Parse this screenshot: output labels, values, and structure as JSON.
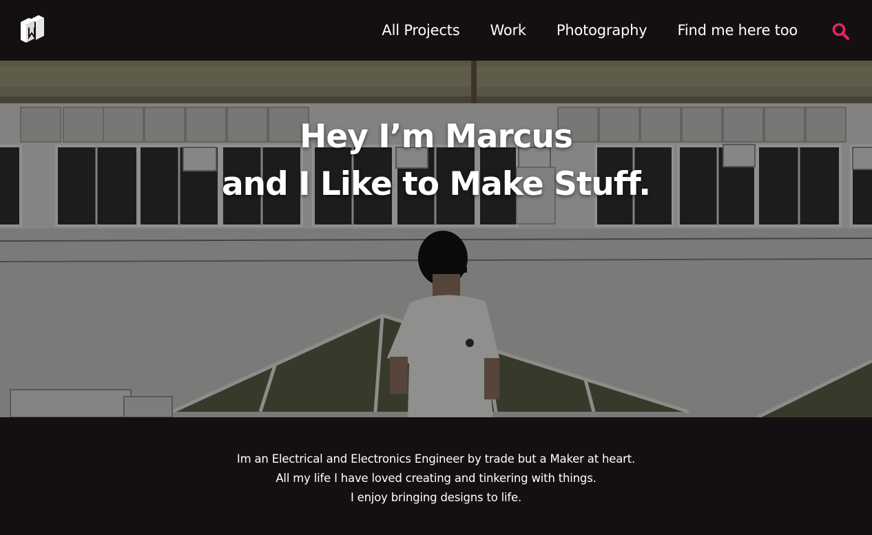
{
  "brand": {
    "logo_icon": "cube-logo-icon"
  },
  "nav": {
    "links": [
      "All Projects",
      "Work",
      "Photography",
      "Find me here too"
    ],
    "search_icon": "search-icon",
    "search_color": "#e8245f"
  },
  "hero": {
    "title_line1": "Hey I’m Marcus",
    "title_line2": "and I Like to Make Stuff."
  },
  "about": {
    "lines": [
      "Im an Electrical and Electronics Engineer by trade but a Maker at heart.",
      "All my life I have loved creating and tinkering with things.",
      "I enjoy bringing designs to life."
    ]
  },
  "colors": {
    "background": "#141011",
    "text": "#ffffff",
    "accent": "#e8245f"
  }
}
